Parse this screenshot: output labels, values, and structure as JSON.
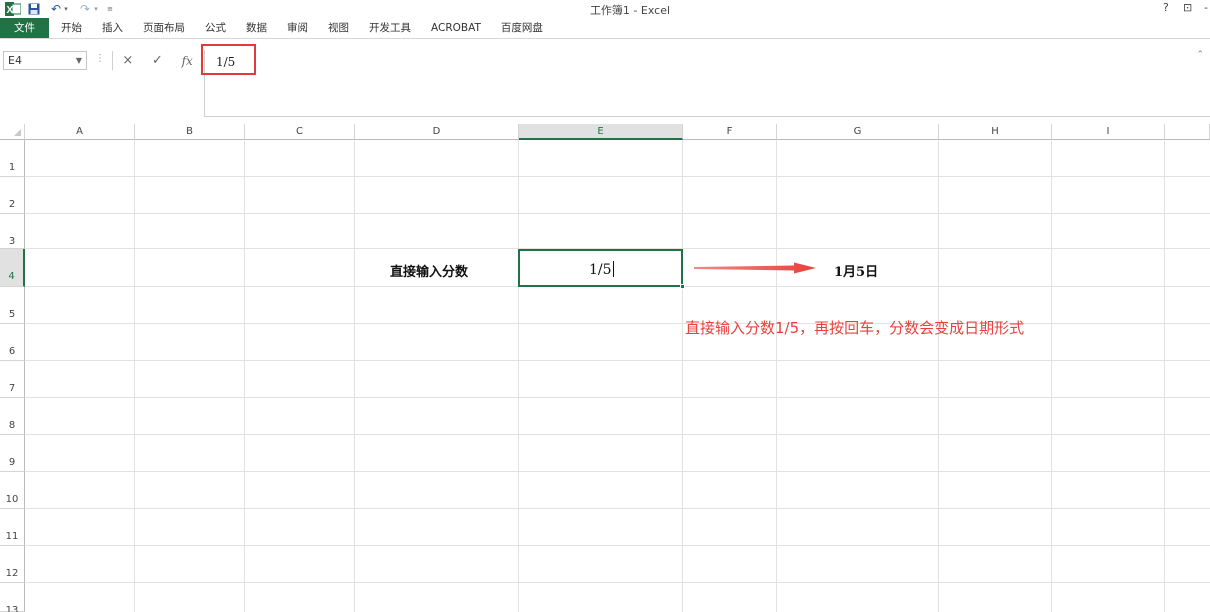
{
  "window": {
    "title": "工作簿1 - Excel",
    "help": "?",
    "restore": "⊡",
    "minimize": "-"
  },
  "quick_access": {
    "logo": "excel-logo",
    "save": "save-icon",
    "undo": "undo-icon",
    "redo": "redo-icon"
  },
  "ribbon": {
    "tabs": [
      "文件",
      "开始",
      "插入",
      "页面布局",
      "公式",
      "数据",
      "审阅",
      "视图",
      "开发工具",
      "ACROBAT",
      "百度网盘"
    ]
  },
  "formula_bar": {
    "name_box": "E4",
    "value": "1/5",
    "cancel_icon": "×",
    "enter_icon": "✓",
    "fx_label": "fx"
  },
  "sheet": {
    "columns": [
      "A",
      "B",
      "C",
      "D",
      "E",
      "F",
      "G",
      "H",
      "I"
    ],
    "rows": [
      "1",
      "2",
      "3",
      "4",
      "5",
      "6",
      "7",
      "8",
      "9",
      "10",
      "11",
      "12",
      "13"
    ],
    "selected_column": "E",
    "selected_row": "4",
    "d4_label": "直接输入分数",
    "e4_value": "1/5",
    "g4_result": "1月5日"
  },
  "annotation": {
    "text": "直接输入分数1/5，再按回车，分数会变成日期形式",
    "color": "#e8413d"
  },
  "colors": {
    "excel_green": "#217346",
    "highlight_red": "#e0393e"
  }
}
